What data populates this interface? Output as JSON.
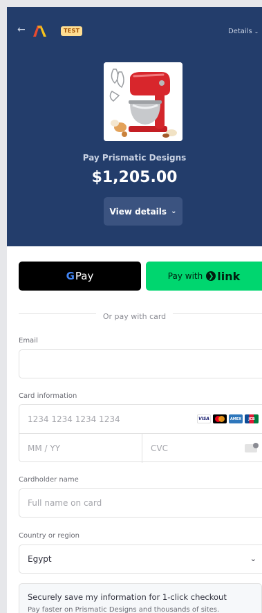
{
  "header": {
    "back_icon": "arrow-left-icon",
    "badge": "TEST",
    "details_label": "Details",
    "merchant_line": "Pay Prismatic Designs",
    "amount": "$1,205.00",
    "view_details_label": "View details",
    "background_color": "#233d6b"
  },
  "express": {
    "gpay_label": "Pay",
    "gpay_g": "G",
    "link_prefix": "Pay with",
    "link_brand": "link"
  },
  "divider_text": "Or pay with card",
  "form": {
    "email_label": "Email",
    "email_value": "",
    "card_label": "Card information",
    "card_number_placeholder": "1234 1234 1234 1234",
    "expiry_placeholder": "MM / YY",
    "cvc_placeholder": "CVC",
    "cardholder_label": "Cardholder name",
    "cardholder_placeholder": "Full name on card",
    "country_label": "Country or region",
    "country_value": "Egypt"
  },
  "save_info": {
    "title": "Securely save my information for 1-click checkout",
    "subtitle": "Pay faster on Prismatic Designs and thousands of sites."
  },
  "colors": {
    "accent_green": "#00d66f",
    "test_badge": "#ffde92"
  }
}
